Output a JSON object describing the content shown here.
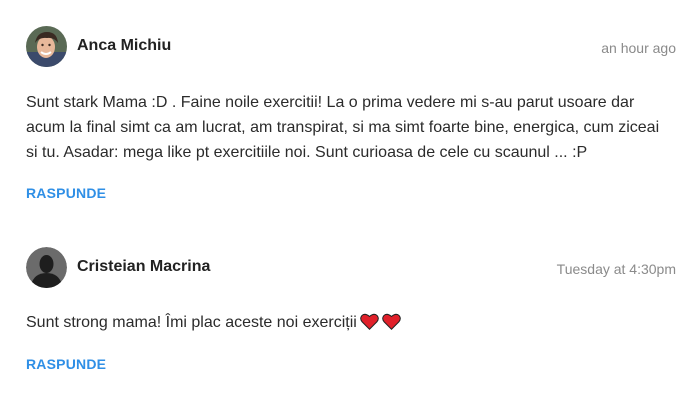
{
  "comments": [
    {
      "author": "Anca Michiu",
      "time": "an hour ago",
      "text": "Sunt stark Mama :D . Faine noile exercitii! La o prima vedere mi s-au parut usoare dar acum la final simt ca am lucrat, am transpirat, si ma simt foarte bine, energica, cum ziceai si tu. Asadar: mega like pt exercitiile noi. Sunt curioasa de cele cu scaunul ... :P",
      "reply_label": "RASPUNDE",
      "avatar": "photo-avatar"
    },
    {
      "author": "Cristeian Macrina",
      "time": "Tuesday at 4:30pm",
      "text": "Sunt strong mama! Îmi plac aceste noi exerciții",
      "emojis": [
        "heart-icon",
        "heart-icon"
      ],
      "reply_label": "RASPUNDE",
      "avatar": "default-user-avatar"
    }
  ],
  "colors": {
    "accent": "#2f8fe6",
    "heart": "#e0202a",
    "timestamp": "#8a8a8a"
  }
}
